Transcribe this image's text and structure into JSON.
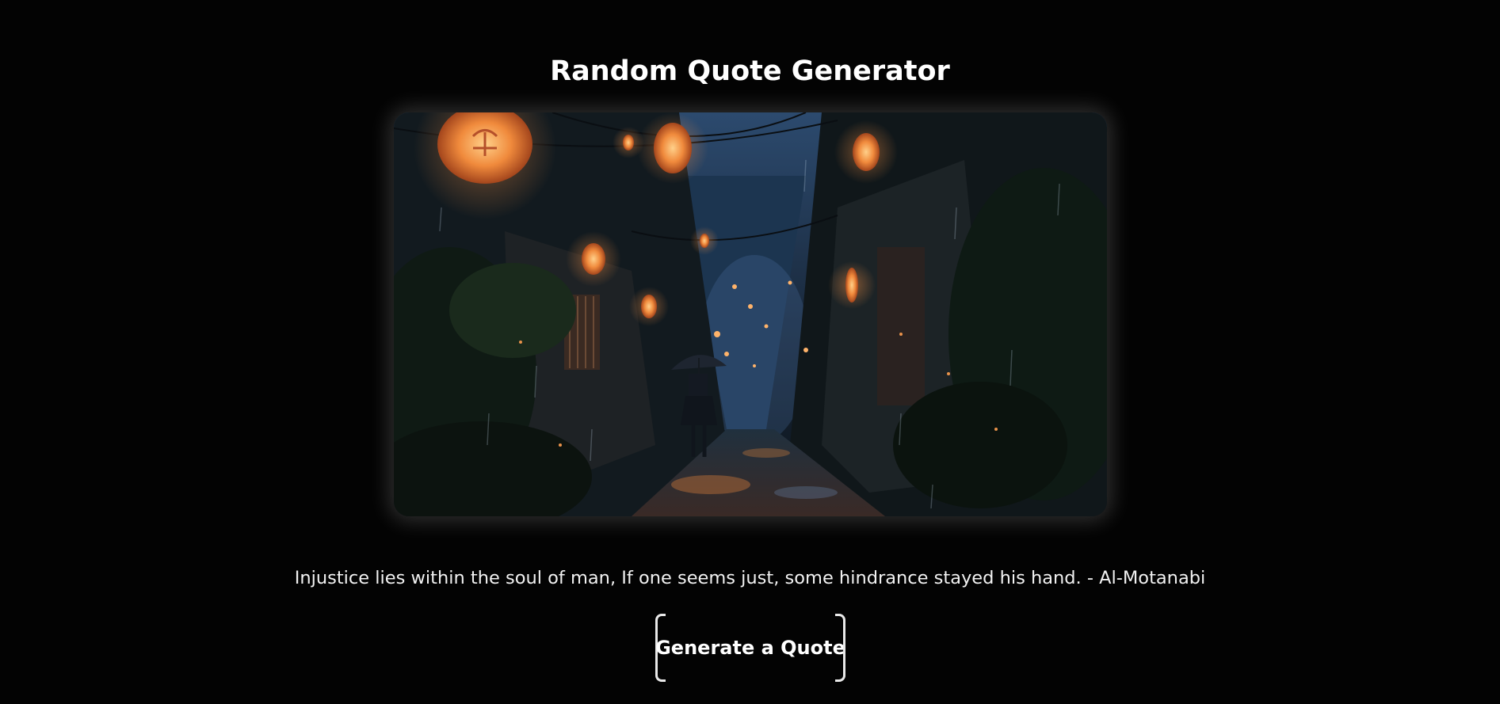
{
  "page": {
    "title": "Random Quote Generator",
    "background_color": "#030303",
    "text_color": "#ffffff"
  },
  "hero_image": {
    "subject": "rainy-lantern-alley-artwork",
    "colors": {
      "lantern": "#f08a3c",
      "sky": "#2c4a6e",
      "shadow": "#0a1014"
    }
  },
  "quote": {
    "text": "Injustice lies within the soul of man, If one seems just, some hindrance stayed his hand. - Al-Motanabi"
  },
  "button": {
    "label": "Generate a Quote"
  }
}
